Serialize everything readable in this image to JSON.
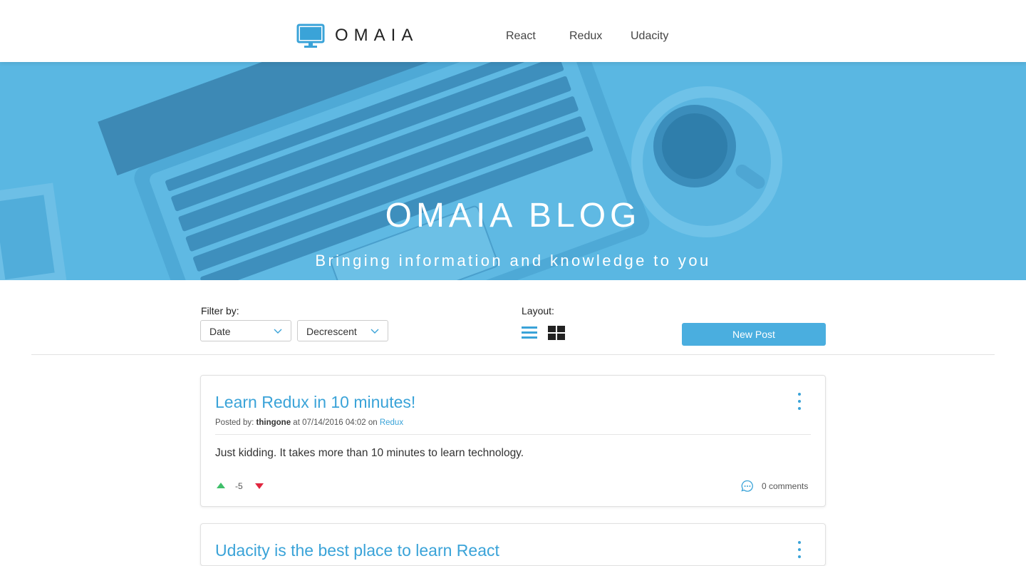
{
  "header": {
    "logo_text": "OMAIA",
    "nav": [
      "React",
      "Redux",
      "Udacity"
    ]
  },
  "hero": {
    "title": "OMAIA BLOG",
    "subtitle": "Bringing information and knowledge to you"
  },
  "controls": {
    "filter_label": "Filter by:",
    "filter_value": "Date",
    "order_value": "Decrescent",
    "layout_label": "Layout:",
    "new_post": "New Post"
  },
  "posts": [
    {
      "title": "Learn Redux in 10 minutes!",
      "posted_by_label": "Posted by:",
      "author": "thingone",
      "at_label": "at",
      "date": "07/14/2016 04:02",
      "on_label": "on",
      "category": "Redux",
      "body": "Just kidding. It takes more than 10 minutes to learn technology.",
      "score": "-5",
      "comments": "0 comments"
    },
    {
      "title": "Udacity is the best place to learn React"
    }
  ],
  "colors": {
    "accent": "#3aa3d8",
    "button": "#4aaedf",
    "hero_overlay": "#56b4e0",
    "vote_up": "#3fbf6a",
    "vote_down": "#e0263f"
  }
}
